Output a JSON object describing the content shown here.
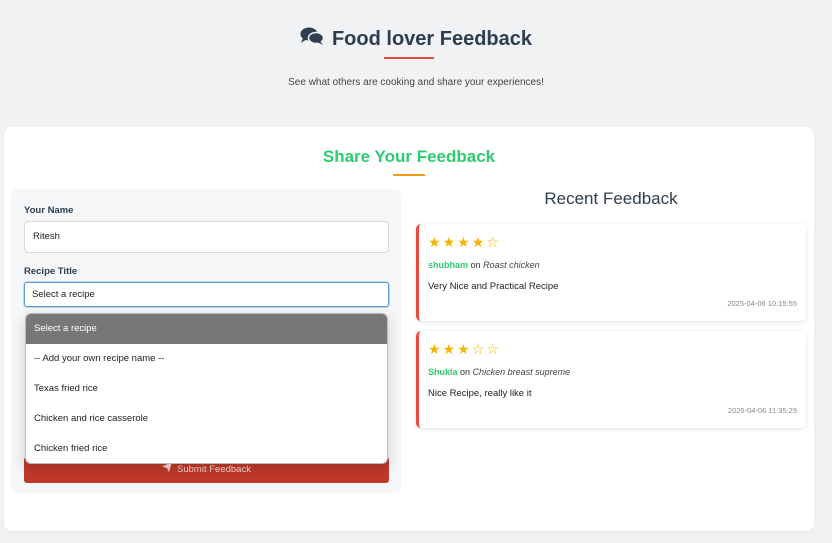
{
  "header": {
    "title": "Food lover Feedback",
    "subtitle": "See what others are cooking and share your experiences!",
    "icon": "comments-icon",
    "accent_color": "#e74c3c"
  },
  "form": {
    "section_title": "Share Your Feedback",
    "name_label": "Your Name",
    "name_value": "Ritesh",
    "recipe_label": "Recipe Title",
    "recipe_selected": "Select a recipe",
    "recipe_options": [
      "Select a recipe",
      "-- Add your own recipe name --",
      "Texas fried rice",
      "Chicken and rice casserole",
      "Chicken fried rice"
    ],
    "submit_label": "Submit Feedback",
    "submit_icon": "paper-plane-icon",
    "section_title_color": "#2ecc71",
    "submit_color": "#c0392b"
  },
  "recent": {
    "title": "Recent Feedback",
    "items": [
      {
        "rating": 4,
        "max_rating": 5,
        "user": "shubham",
        "on_text": "on",
        "recipe": "Roast chicken",
        "comment": "Very Nice and Practical Recipe",
        "date": "2025-04-06 10:15:55"
      },
      {
        "rating": 3,
        "max_rating": 5,
        "user": "Shukla",
        "on_text": "on",
        "recipe": "Chicken breast supreme",
        "comment": "Nice Recipe, really like it",
        "date": "2025-04-06 11:35:29"
      }
    ]
  }
}
